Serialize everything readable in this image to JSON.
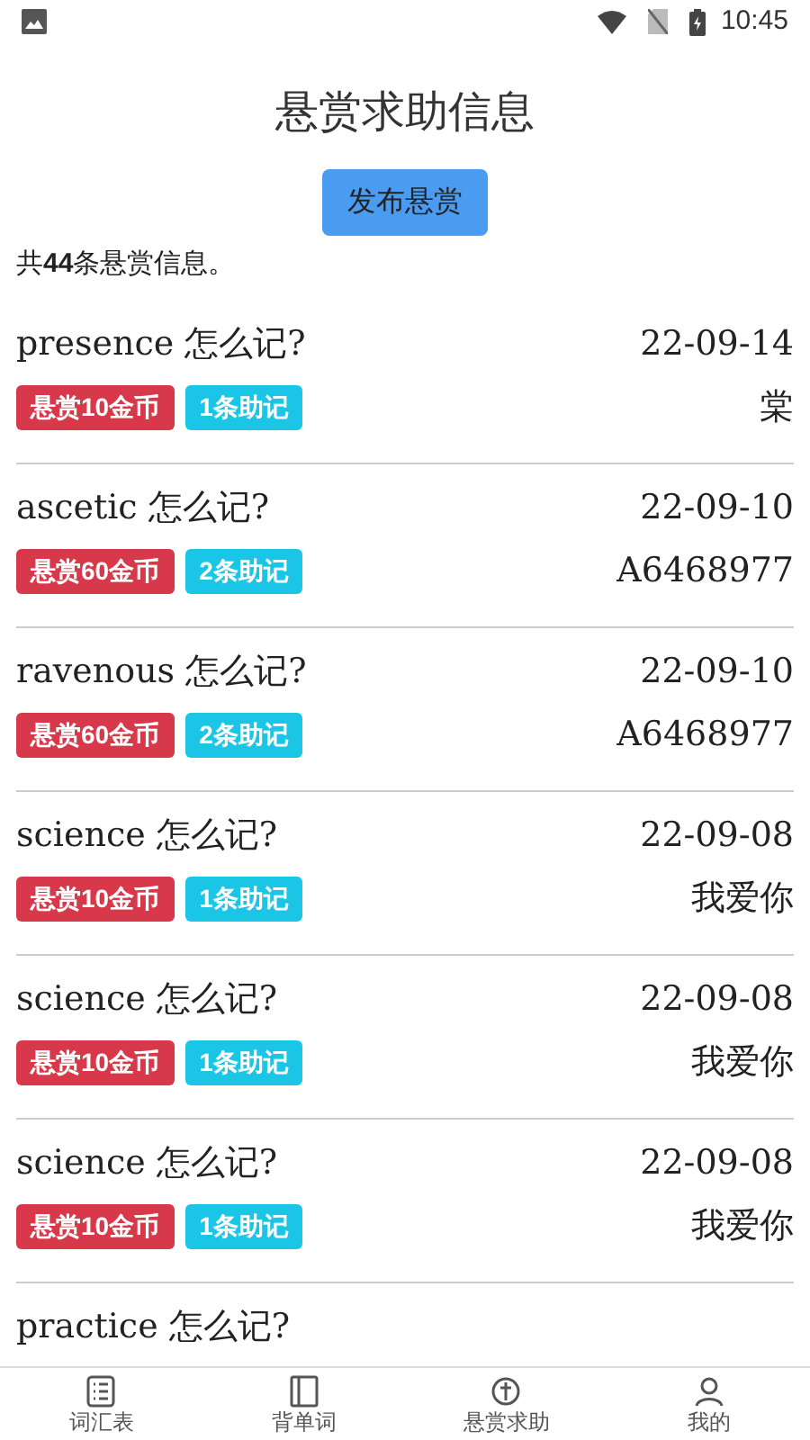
{
  "status_bar": {
    "time": "10:45"
  },
  "title": "悬赏求助信息",
  "publish_button": "发布悬赏",
  "summary": "共**44**条悬赏信息。",
  "posts": [
    {
      "title": "presence 怎么记?",
      "date": "22-09-14",
      "reward": "悬赏10金币",
      "notes": "1条助记",
      "author": "棠"
    },
    {
      "title": "ascetic 怎么记?",
      "date": "22-09-10",
      "reward": "悬赏60金币",
      "notes": "2条助记",
      "author": "A6468977"
    },
    {
      "title": "ravenous 怎么记?",
      "date": "22-09-10",
      "reward": "悬赏60金币",
      "notes": "2条助记",
      "author": "A6468977"
    },
    {
      "title": "science 怎么记?",
      "date": "22-09-08",
      "reward": "悬赏10金币",
      "notes": "1条助记",
      "author": "我爱你"
    },
    {
      "title": "science 怎么记?",
      "date": "22-09-08",
      "reward": "悬赏10金币",
      "notes": "1条助记",
      "author": "我爱你"
    },
    {
      "title": "science 怎么记?",
      "date": "22-09-08",
      "reward": "悬赏10金币",
      "notes": "1条助记",
      "author": "我爱你"
    },
    {
      "title": "practice 怎么记?"
    }
  ],
  "bottom_nav": [
    {
      "label": "词汇表",
      "selected": false
    },
    {
      "label": "背单词",
      "selected": false
    },
    {
      "label": "悬赏求助",
      "selected": false
    },
    {
      "label": "我的",
      "selected": false
    }
  ]
}
